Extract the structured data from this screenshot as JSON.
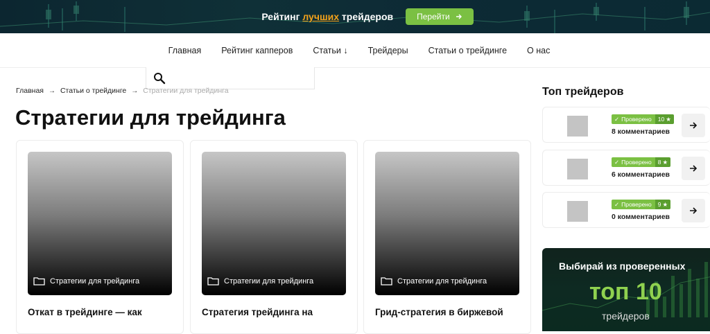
{
  "banner": {
    "text_before": "Рейтинг ",
    "text_highlight": "лучших",
    "text_after": " трейдеров",
    "button_label": "Перейти",
    "accent": "#f2a21b",
    "button_color": "#7bc043"
  },
  "nav": {
    "items": [
      "Главная",
      "Рейтинг капперов",
      "Статьи ↓",
      "Трейдеры",
      "Статьи о трейдинге",
      "О нас"
    ]
  },
  "search": {
    "icon": "search-icon"
  },
  "breadcrumbs": {
    "home": "Главная",
    "section": "Статьи о трейдинге",
    "current": "Стратегии для трейдинга"
  },
  "page_title": "Стратегии для трейдинга",
  "cards": [
    {
      "category": "Стратегии для трейдинга",
      "title": "Откат в трейдинге — как"
    },
    {
      "category": "Стратегии для трейдинга",
      "title": "Стратегия трейдинга на"
    },
    {
      "category": "Стратегии для трейдинга",
      "title": "Грид-стратегия в биржевой"
    }
  ],
  "sidebar": {
    "title": "Топ трейдеров",
    "traders": [
      {
        "badge": "Проверено",
        "rating": "10",
        "comments": "8 комментариев"
      },
      {
        "badge": "Проверено",
        "rating": "8",
        "comments": "6 комментариев"
      },
      {
        "badge": "Проверено",
        "rating": "9",
        "comments": "0 комментариев"
      }
    ],
    "promo": {
      "line1": "Выбирай из проверенных",
      "line2": "топ 10",
      "line3": "трейдеров"
    }
  }
}
